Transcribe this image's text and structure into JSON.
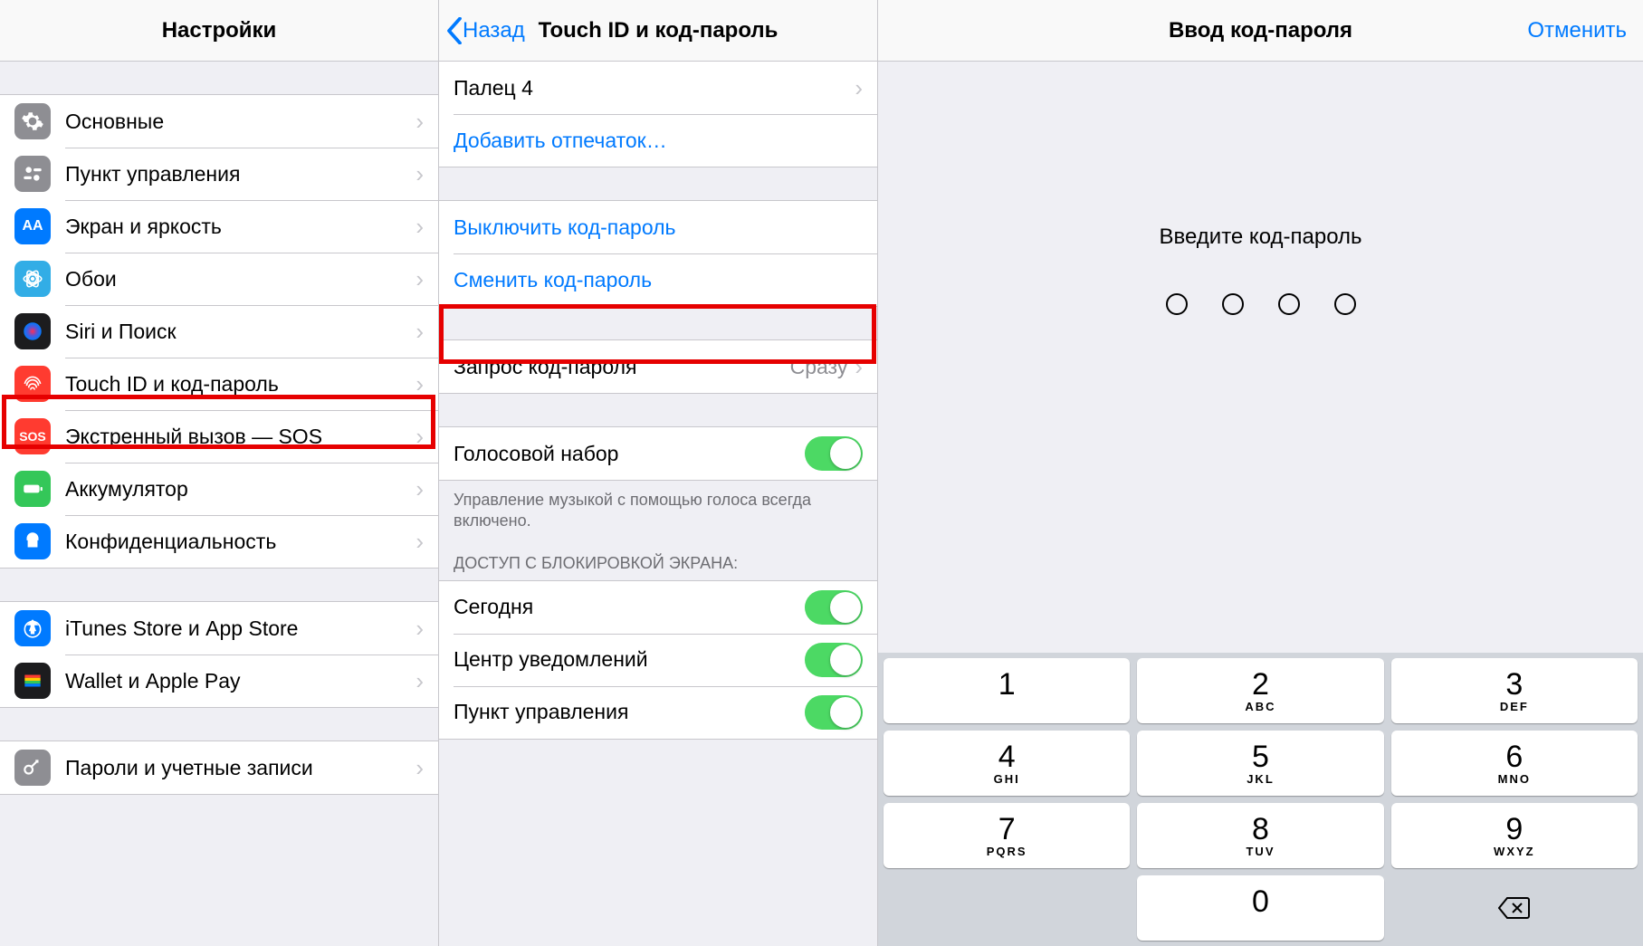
{
  "col1": {
    "title": "Настройки",
    "groups": [
      [
        {
          "icon": "general",
          "label": "Основные"
        },
        {
          "icon": "control",
          "label": "Пункт управления"
        },
        {
          "icon": "display",
          "label": "Экран и яркость"
        },
        {
          "icon": "wallpaper",
          "label": "Обои"
        },
        {
          "icon": "siri",
          "label": "Siri и Поиск"
        },
        {
          "icon": "touch",
          "label": "Touch ID и код-пароль"
        },
        {
          "icon": "sos",
          "label": "Экстренный вызов — SOS"
        },
        {
          "icon": "battery",
          "label": "Аккумулятор"
        },
        {
          "icon": "privacy",
          "label": "Конфиденциальность"
        }
      ],
      [
        {
          "icon": "itunes",
          "label": "iTunes Store и App Store"
        },
        {
          "icon": "wallet",
          "label": "Wallet и Apple Pay"
        }
      ],
      [
        {
          "icon": "accounts",
          "label": "Пароли и учетные записи"
        }
      ]
    ]
  },
  "col2": {
    "back": "Назад",
    "title": "Touch ID и код-пароль",
    "finger": "Палец 4",
    "add_finger": "Добавить отпечаток…",
    "turn_off": "Выключить код-пароль",
    "change": "Сменить код-пароль",
    "require_label": "Запрос код-пароля",
    "require_value": "Сразу",
    "voice_dial": "Голосовой набор",
    "voice_footer": "Управление музыкой с помощью голоса всегда включено.",
    "lock_header": "ДОСТУП С БЛОКИРОВКОЙ ЭКРАНА:",
    "today": "Сегодня",
    "notif": "Центр уведомлений",
    "ctrl": "Пункт управления"
  },
  "col3": {
    "title": "Ввод код-пароля",
    "cancel": "Отменить",
    "prompt": "Введите код-пароль",
    "keys": [
      {
        "d": "1",
        "l": ""
      },
      {
        "d": "2",
        "l": "ABC"
      },
      {
        "d": "3",
        "l": "DEF"
      },
      {
        "d": "4",
        "l": "GHI"
      },
      {
        "d": "5",
        "l": "JKL"
      },
      {
        "d": "6",
        "l": "MNO"
      },
      {
        "d": "7",
        "l": "PQRS"
      },
      {
        "d": "8",
        "l": "TUV"
      },
      {
        "d": "9",
        "l": "WXYZ"
      },
      {
        "d": "",
        "l": "",
        "blank": true
      },
      {
        "d": "0",
        "l": ""
      },
      {
        "d": "",
        "l": "",
        "backspace": true
      }
    ]
  }
}
